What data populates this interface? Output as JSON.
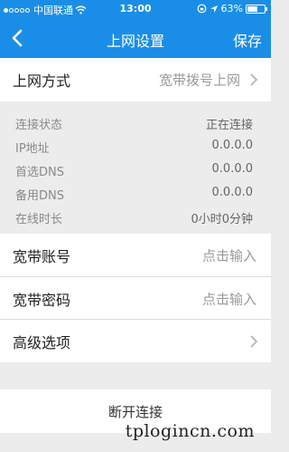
{
  "status_bar": {
    "carrier": "中国联通",
    "time": "13:00",
    "battery": "63%",
    "battery_level": 0.63,
    "signal_icon": "signal-dots-icon",
    "wifi_icon": "wifi-icon",
    "lock_icon": "rotation-lock-icon",
    "location_icon": "location-arrow-icon"
  },
  "nav": {
    "title": "上网设置",
    "save": "保存",
    "back_icon": "chevron-left-icon"
  },
  "connection_type": {
    "label": "上网方式",
    "value": "宽带拨号上网"
  },
  "info": [
    {
      "key": "连接状态",
      "value": "正在连接"
    },
    {
      "key": "IP地址",
      "value": "0.0.0.0"
    },
    {
      "key": "首选DNS",
      "value": "0.0.0.0"
    },
    {
      "key": "备用DNS",
      "value": "0.0.0.0"
    },
    {
      "key": "在线时长",
      "value": "0小时0分钟"
    }
  ],
  "account": {
    "label": "宽带账号",
    "placeholder": "点击输入"
  },
  "password": {
    "label": "宽带密码",
    "placeholder": "点击输入"
  },
  "advanced": {
    "label": "高级选项"
  },
  "disconnect": {
    "label": "断开连接"
  },
  "watermark": "tplogincn.com",
  "colors": {
    "accent": "#1a8ee6",
    "background": "#ececec"
  }
}
